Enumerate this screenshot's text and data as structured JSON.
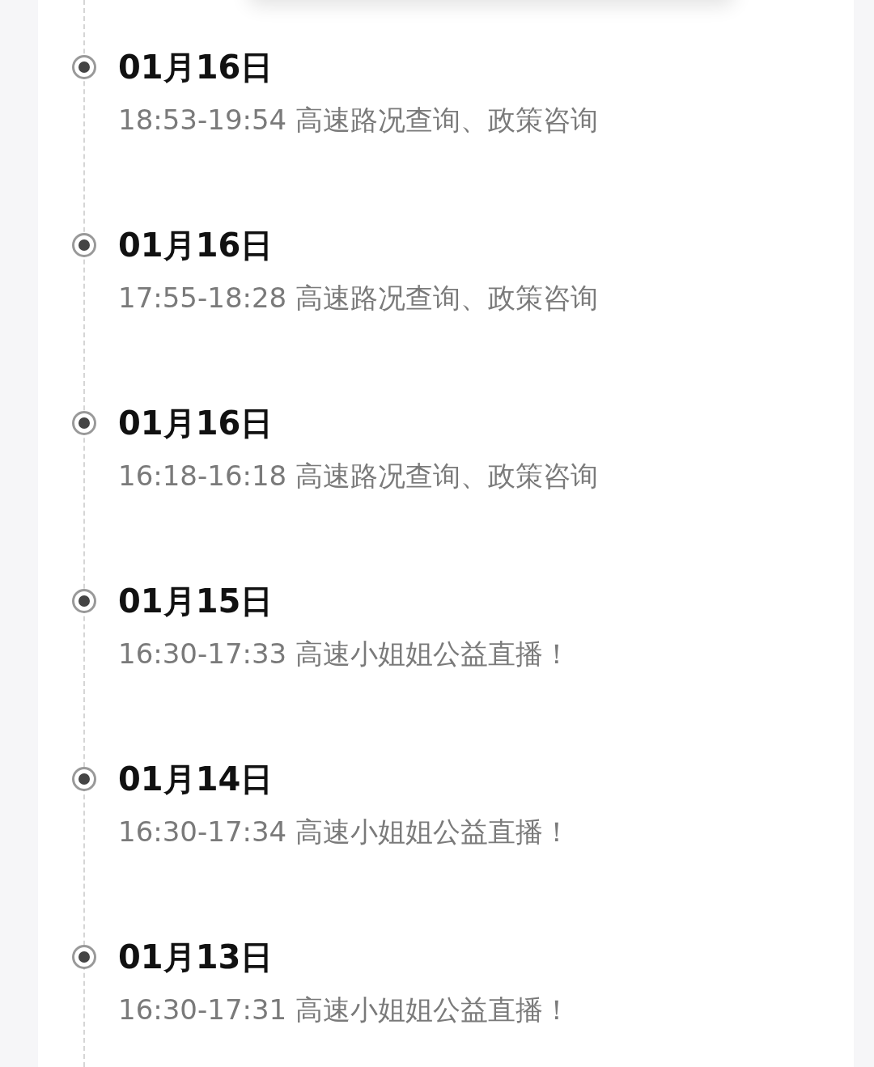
{
  "timeline": [
    {
      "date": "01月16日",
      "detail": "18:53-19:54 高速路况查询、政策咨询"
    },
    {
      "date": "01月16日",
      "detail": "17:55-18:28 高速路况查询、政策咨询"
    },
    {
      "date": "01月16日",
      "detail": "16:18-16:18 高速路况查询、政策咨询"
    },
    {
      "date": "01月15日",
      "detail": "16:30-17:33 高速小姐姐公益直播！"
    },
    {
      "date": "01月14日",
      "detail": "16:30-17:34 高速小姐姐公益直播！"
    },
    {
      "date": "01月13日",
      "detail": "16:30-17:31 高速小姐姐公益直播！"
    }
  ]
}
